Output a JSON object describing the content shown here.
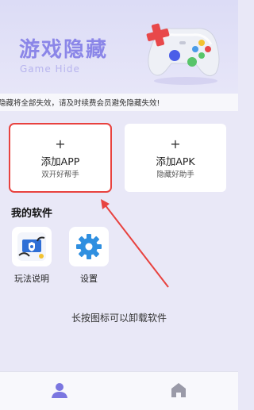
{
  "hero": {
    "title": "游戏隐藏",
    "subtitle": "Game Hide",
    "icon": "gamepad-icon"
  },
  "notice": {
    "text": "隐藏将全部失效，请及时续费会员避免隐藏失效!"
  },
  "actions": [
    {
      "plus": "+",
      "title": "添加APP",
      "subtitle": "双开好帮手",
      "highlighted": true
    },
    {
      "plus": "+",
      "title": "添加APK",
      "subtitle": "隐藏好助手",
      "highlighted": false
    }
  ],
  "my_apps": {
    "title": "我的软件",
    "items": [
      {
        "label": "玩法说明",
        "icon": "guide-icon"
      },
      {
        "label": "设置",
        "icon": "gear-icon"
      }
    ]
  },
  "hint": "长按图标可以卸载软件",
  "tabbar": {
    "tabs": [
      {
        "icon": "person-icon",
        "active": true
      },
      {
        "icon": "home-icon",
        "active": false
      }
    ]
  },
  "colors": {
    "accent": "#8b86e8",
    "highlight": "#e8423f",
    "active_tab": "#7b76e0",
    "inactive_tab": "#9a9aa8"
  }
}
